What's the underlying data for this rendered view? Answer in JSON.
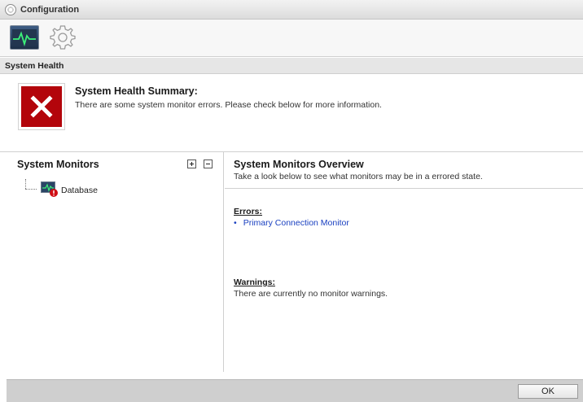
{
  "window": {
    "title": "Configuration",
    "icon": "gear-icon"
  },
  "toolbar": {
    "items": [
      {
        "icon": "system-health-monitor-icon",
        "selected": true
      },
      {
        "icon": "gear-icon",
        "selected": false
      }
    ]
  },
  "section": {
    "title": "System Health"
  },
  "summary": {
    "status_icon": "error-x-icon",
    "title": "System Health Summary:",
    "text": "There are some system monitor errors. Please check below for more information."
  },
  "monitors_panel": {
    "title": "System Monitors",
    "expand_icon": "expand-all-icon",
    "collapse_icon": "collapse-all-icon",
    "tree": [
      {
        "label": "Database",
        "icon": "database-monitor-error-icon"
      }
    ]
  },
  "overview": {
    "title": "System Monitors Overview",
    "subtitle": "Take a look below to see what monitors may be in a errored state.",
    "errors_heading": "Errors:",
    "errors": [
      "Primary Connection Monitor"
    ],
    "warnings_heading": "Warnings:",
    "warnings_text": "There are currently no monitor warnings."
  },
  "footer": {
    "ok_label": "OK"
  },
  "colors": {
    "error_red": "#b3050b",
    "link_blue": "#1a40c0"
  }
}
